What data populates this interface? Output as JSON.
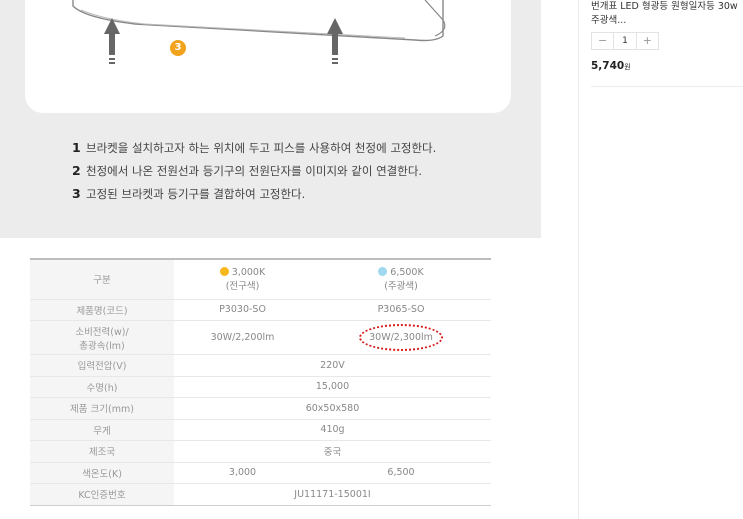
{
  "install": {
    "step_badge": "3",
    "steps": [
      {
        "num": "1",
        "text": "브라켓을 설치하고자 하는 위치에 두고 피스를 사용하여 천정에 고정한다."
      },
      {
        "num": "2",
        "text": "천정에서 나온 전원선과 등기구의 전원단자를 이미지와 같이 연결한다."
      },
      {
        "num": "3",
        "text": "고정된 브라켓과 등기구를 결합하여 고정한다."
      }
    ]
  },
  "spec": {
    "header": {
      "label": "구분",
      "warm": {
        "name": "3,000K",
        "sub": "(전구색)",
        "color": "#f6b71b"
      },
      "cool": {
        "name": "6,500K",
        "sub": "(주광색)",
        "color": "#9fd8ef"
      }
    },
    "rows": {
      "code": {
        "label": "제품명(코드)",
        "warm": "P3030-SO",
        "cool": "P3065-SO"
      },
      "power": {
        "label_1": "소비전력(w)/",
        "label_2": "총광속(lm)",
        "warm": "30W/2,200lm",
        "cool": "30W/2,300lm"
      },
      "voltage": {
        "label": "입력전압(V)",
        "value": "220V"
      },
      "life": {
        "label": "수명(h)",
        "value": "15,000"
      },
      "size": {
        "label": "제품 크기(mm)",
        "value": "60x50x580"
      },
      "weight": {
        "label": "무게",
        "value": "410g"
      },
      "origin": {
        "label": "제조국",
        "value": "중국"
      },
      "color_temp": {
        "label": "색온도(K)",
        "warm": "3,000",
        "cool": "6,500"
      },
      "kc": {
        "label": "KC인증번호",
        "value": "JU11171-15001I"
      }
    }
  },
  "sidebar": {
    "product_title": "번개표 LED 형광등 원형일자등 30w 주광색...",
    "quantity": "1",
    "minus": "−",
    "plus": "+",
    "price": "5,740",
    "price_unit": "원"
  }
}
